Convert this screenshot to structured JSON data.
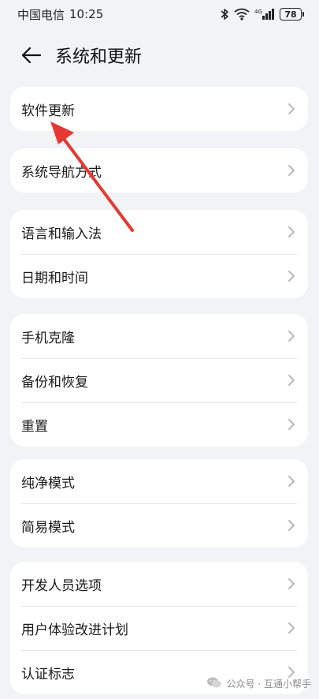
{
  "status_bar": {
    "carrier": "中国电信",
    "time": "10:25",
    "network": "4G",
    "battery": "78"
  },
  "header": {
    "title": "系统和更新"
  },
  "groups": [
    {
      "items": [
        {
          "label": "软件更新"
        }
      ]
    },
    {
      "items": [
        {
          "label": "系统导航方式"
        }
      ]
    },
    {
      "items": [
        {
          "label": "语言和输入法"
        },
        {
          "label": "日期和时间"
        }
      ]
    },
    {
      "items": [
        {
          "label": "手机克隆"
        },
        {
          "label": "备份和恢复"
        },
        {
          "label": "重置"
        }
      ]
    },
    {
      "items": [
        {
          "label": "纯净模式"
        },
        {
          "label": "简易模式"
        }
      ]
    },
    {
      "items": [
        {
          "label": "开发人员选项"
        },
        {
          "label": "用户体验改进计划"
        },
        {
          "label": "认证标志"
        }
      ]
    }
  ],
  "annotation": {
    "arrow_color": "#e53935"
  },
  "watermark": {
    "text": "公众号 · 互通小帮手"
  }
}
